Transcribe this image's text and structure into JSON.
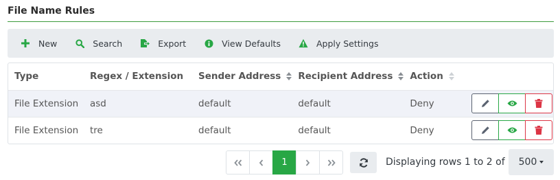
{
  "page": {
    "title": "File Name Rules"
  },
  "toolbar": {
    "new_label": "New",
    "search_label": "Search",
    "export_label": "Export",
    "view_defaults_label": "View Defaults",
    "apply_settings_label": "Apply Settings"
  },
  "table": {
    "columns": [
      "Type",
      "Regex / Extension",
      "Sender Address",
      "Recipient Address",
      "Action"
    ],
    "rows": [
      {
        "type": "File Extension",
        "regex": "asd",
        "sender": "default",
        "recipient": "default",
        "action": "Deny"
      },
      {
        "type": "File Extension",
        "regex": "tre",
        "sender": "default",
        "recipient": "default",
        "action": "Deny"
      }
    ]
  },
  "pagination": {
    "current_page": "1",
    "status": "Displaying rows 1 to 2 of 2",
    "page_size": "500"
  },
  "icons": {
    "new": "plus-icon",
    "search": "search-icon",
    "export": "export-icon",
    "view_defaults": "info-icon",
    "apply_settings": "warning-icon",
    "edit": "pencil-icon",
    "view": "eye-icon",
    "delete": "trash-icon",
    "refresh": "refresh-icon"
  },
  "colors": {
    "accent": "#28a745",
    "danger": "#dc3545",
    "edit": "#5a6270",
    "toolbar_bg": "#e9ecef"
  }
}
